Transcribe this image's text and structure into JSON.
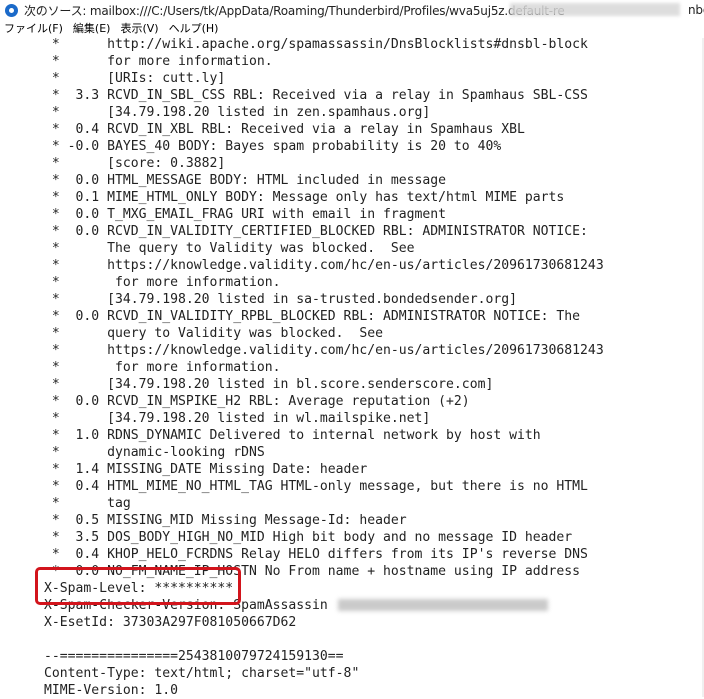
{
  "window": {
    "title": "次のソース: mailbox:///C:/Users/tk/AppData/Roaming/Thunderbird/Profiles/wva5uj5z.default-re",
    "title_suffix": "nbo"
  },
  "menu": [
    {
      "label": "ファイル(F)"
    },
    {
      "label": "編集(E)"
    },
    {
      "label": "表示(V)"
    },
    {
      "label": "ヘルプ(H)"
    }
  ],
  "source_lines": [
    " *      http://wiki.apache.org/spamassassin/DnsBlocklists#dnsbl-block",
    " *      for more information.",
    " *      [URIs: cutt.ly]",
    " *  3.3 RCVD_IN_SBL_CSS RBL: Received via a relay in Spamhaus SBL-CSS",
    " *      [34.79.198.20 listed in zen.spamhaus.org]",
    " *  0.4 RCVD_IN_XBL RBL: Received via a relay in Spamhaus XBL",
    " * -0.0 BAYES_40 BODY: Bayes spam probability is 20 to 40%",
    " *      [score: 0.3882]",
    " *  0.0 HTML_MESSAGE BODY: HTML included in message",
    " *  0.1 MIME_HTML_ONLY BODY: Message only has text/html MIME parts",
    " *  0.0 T_MXG_EMAIL_FRAG URI with email in fragment",
    " *  0.0 RCVD_IN_VALIDITY_CERTIFIED_BLOCKED RBL: ADMINISTRATOR NOTICE:",
    " *      The query to Validity was blocked.  See",
    " *      https://knowledge.validity.com/hc/en-us/articles/20961730681243",
    " *       for more information.",
    " *      [34.79.198.20 listed in sa-trusted.bondedsender.org]",
    " *  0.0 RCVD_IN_VALIDITY_RPBL_BLOCKED RBL: ADMINISTRATOR NOTICE: The",
    " *      query to Validity was blocked.  See",
    " *      https://knowledge.validity.com/hc/en-us/articles/20961730681243",
    " *       for more information.",
    " *      [34.79.198.20 listed in bl.score.senderscore.com]",
    " *  0.0 RCVD_IN_MSPIKE_H2 RBL: Average reputation (+2)",
    " *      [34.79.198.20 listed in wl.mailspike.net]",
    " *  1.0 RDNS_DYNAMIC Delivered to internal network by host with",
    " *      dynamic-looking rDNS",
    " *  1.4 MISSING_DATE Missing Date: header",
    " *  0.4 HTML_MIME_NO_HTML_TAG HTML-only message, but there is no HTML",
    " *      tag",
    " *  0.5 MISSING_MID Missing Message-Id: header",
    " *  3.5 DOS_BODY_HIGH_NO_MID High bit body and no message ID header",
    " *  0.4 KHOP_HELO_FCRDNS Relay HELO differs from its IP's reverse DNS",
    " *  0.0 NO_FM_NAME_IP_HOSTN No From name + hostname using IP address",
    "X-Spam-Level: **********",
    "X-Spam-Checker-Version: SpamAssassin",
    "X-EsetId: 37303A297F081050667D62",
    "",
    "--===============2543810079724159130==",
    "Content-Type: text/html; charset=\"utf-8\"",
    "MIME-Version: 1.0"
  ],
  "highlight": {
    "color": "#d2141c"
  }
}
